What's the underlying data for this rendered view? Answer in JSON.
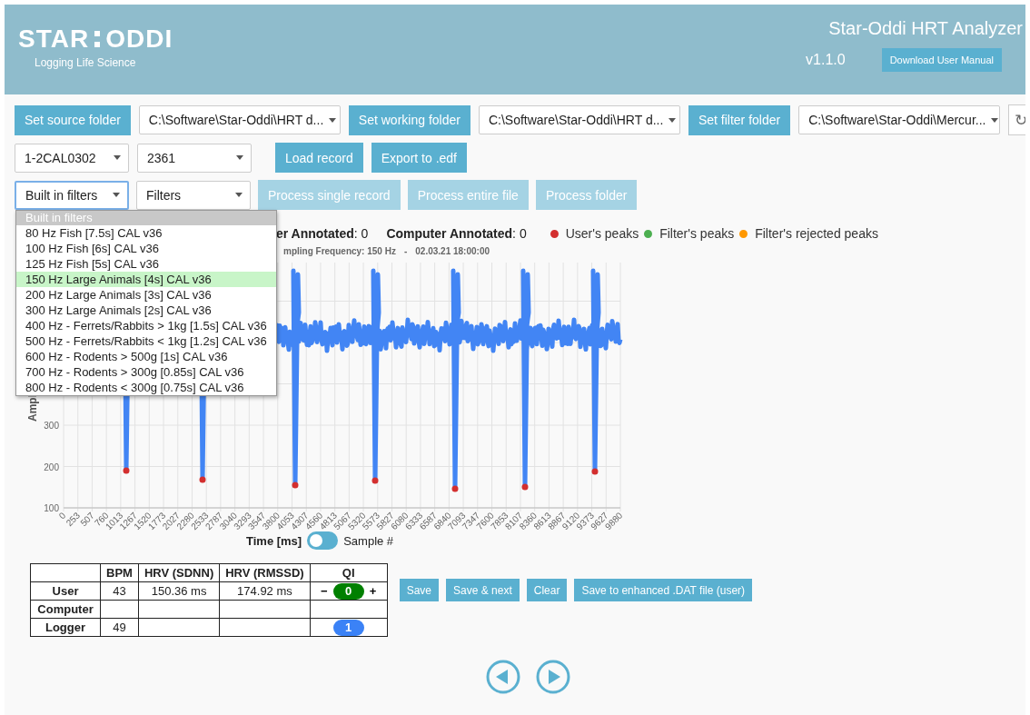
{
  "header": {
    "logo_left": "STAR",
    "logo_right": "ODDI",
    "tagline": "Logging Life Science",
    "title": "Star-Oddi HRT Analyzer",
    "version": "v1.1.0",
    "manual_button": "Download User Manual"
  },
  "folders": [
    {
      "button": "Set source folder",
      "path": "C:\\Software\\Star-Oddi\\HRT d..."
    },
    {
      "button": "Set working folder",
      "path": "C:\\Software\\Star-Oddi\\HRT d..."
    },
    {
      "button": "Set filter folder",
      "path": "C:\\Software\\Star-Oddi\\Mercur..."
    }
  ],
  "refresh_symbol": "↻",
  "record_row": {
    "selects": [
      "1-2CAL0302",
      "2361"
    ],
    "buttons": [
      {
        "label": "Load record",
        "disabled": false
      },
      {
        "label": "Export to .edf",
        "disabled": false
      }
    ]
  },
  "filter_row": {
    "selects": [
      {
        "value": "Built in filters",
        "focused": true
      },
      {
        "value": "Filters",
        "focused": false
      }
    ],
    "buttons": [
      {
        "label": "Process single record",
        "disabled": true
      },
      {
        "label": "Process entire file",
        "disabled": true
      },
      {
        "label": "Process folder",
        "disabled": true
      }
    ]
  },
  "dropdown": {
    "header": "Built in filters",
    "items": [
      {
        "label": "80 Hz Fish [7.5s] CAL v36",
        "selected": false
      },
      {
        "label": "100 Hz Fish [6s] CAL v36",
        "selected": false
      },
      {
        "label": "125 Hz Fish [5s] CAL v36",
        "selected": false
      },
      {
        "label": "150 Hz Large Animals [4s] CAL v36",
        "selected": true
      },
      {
        "label": "200 Hz Large Animals [3s] CAL v36",
        "selected": false
      },
      {
        "label": "300 Hz Large Animals [2s] CAL v36",
        "selected": false
      },
      {
        "label": "400 Hz - Ferrets/Rabbits > 1kg [1.5s] CAL v36",
        "selected": false
      },
      {
        "label": "500 Hz - Ferrets/Rabbits < 1kg [1.2s] CAL v36",
        "selected": false
      },
      {
        "label": "600 Hz - Rodents > 500g [1s] CAL v36",
        "selected": false
      },
      {
        "label": "700 Hz - Rodents > 300g [0.85s] CAL v36",
        "selected": false
      },
      {
        "label": "800 Hz - Rodents < 300g [0.75s] CAL v36",
        "selected": false
      }
    ]
  },
  "annotations": [
    {
      "label": "er Annotated",
      "value": ": 0"
    },
    {
      "label": "Computer Annotated",
      "value": ": 0"
    }
  ],
  "legend": [
    {
      "label": "User's peaks",
      "color": "#d32f2f"
    },
    {
      "label": "Filter's peaks",
      "color": "#4caf50"
    },
    {
      "label": "Filter's rejected peaks",
      "color": "#ff9800"
    }
  ],
  "chart": {
    "subtitle": "mpling Frequency: 150 Hz",
    "separator": "-",
    "timestamp": "02.03.21 18:00:00",
    "y_axis_label": "Ampl",
    "y_ticks": [
      "300",
      "200",
      "100"
    ],
    "x_ticks": [
      "0",
      "253",
      "507",
      "760",
      "1013",
      "1267",
      "1520",
      "1773",
      "2027",
      "2280",
      "2533",
      "2787",
      "3040",
      "3293",
      "3547",
      "3800",
      "4053",
      "4307",
      "4560",
      "4813",
      "5067",
      "5320",
      "5573",
      "5827",
      "6080",
      "6333",
      "6587",
      "6840",
      "7093",
      "7347",
      "7600",
      "7853",
      "8107",
      "8360",
      "8613",
      "8867",
      "9120",
      "9373",
      "9627",
      "9880"
    ]
  },
  "axis_toggle": {
    "left": "Time [ms]",
    "right": "Sample #",
    "on": false
  },
  "results": {
    "columns": [
      "BPM",
      "HRV (SDNN)",
      "HRV (RMSSD)",
      "QI"
    ],
    "rows": [
      {
        "name": "User",
        "cells": [
          "43",
          "150.36 ms",
          "174.92 ms"
        ],
        "qi": {
          "minus": "−",
          "value": "0",
          "plus": "+",
          "color": "#008000"
        }
      },
      {
        "name": "Computer",
        "cells": [
          "",
          "",
          ""
        ]
      },
      {
        "name": "Logger",
        "cells": [
          "49",
          "",
          ""
        ],
        "qi": {
          "value": "1",
          "color": "#3b82f6"
        }
      }
    ]
  },
  "actions": [
    "Save",
    "Save & next",
    "Clear",
    "Save to enhanced .DAT file (user)"
  ],
  "nav": [
    {
      "kind": "prev"
    },
    {
      "kind": "next"
    }
  ]
}
